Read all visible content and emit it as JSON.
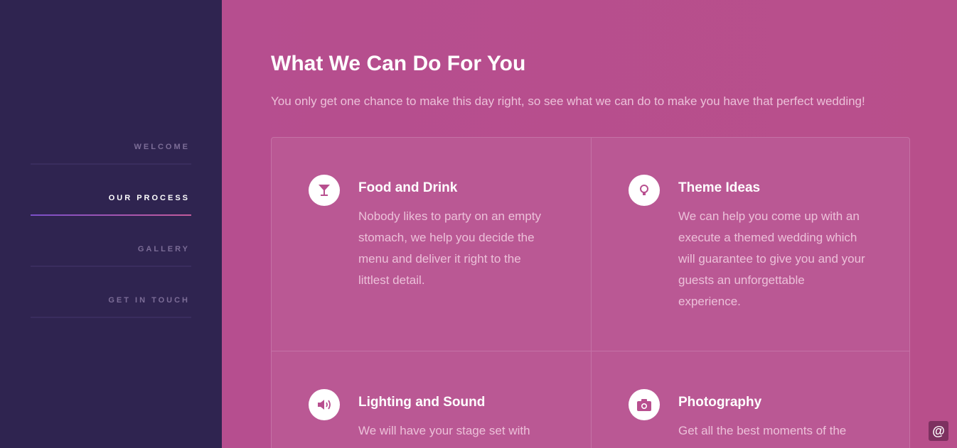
{
  "nav": {
    "items": [
      {
        "label": "WELCOME",
        "active": false
      },
      {
        "label": "OUR PROCESS",
        "active": true
      },
      {
        "label": "GALLERY",
        "active": false
      },
      {
        "label": "GET IN TOUCH",
        "active": false
      }
    ]
  },
  "header": {
    "title": "What We Can Do For You",
    "subtitle": "You only get one chance to make this day right, so see what we can do to make you have that perfect wedding!"
  },
  "services": [
    {
      "icon": "cocktail-icon",
      "title": "Food and Drink",
      "description": "Nobody likes to party on an empty stomach, we help you decide the menu and deliver it right to the littlest detail."
    },
    {
      "icon": "lightbulb-icon",
      "title": "Theme Ideas",
      "description": "We can help you come up with an execute a themed wedding which will guarantee to give you and your guests an unforgettable experience."
    },
    {
      "icon": "speaker-icon",
      "title": "Lighting and Sound",
      "description": "We will have your stage set with"
    },
    {
      "icon": "camera-icon",
      "title": "Photography",
      "description": "Get all the best moments of the"
    }
  ],
  "contact_button": {
    "label": "@",
    "icon": "at-icon"
  },
  "colors": {
    "sidebar": "#2f2450",
    "main": "#b74e8e",
    "accent": "#ffffff",
    "muted_text": "#ecc0d9"
  }
}
